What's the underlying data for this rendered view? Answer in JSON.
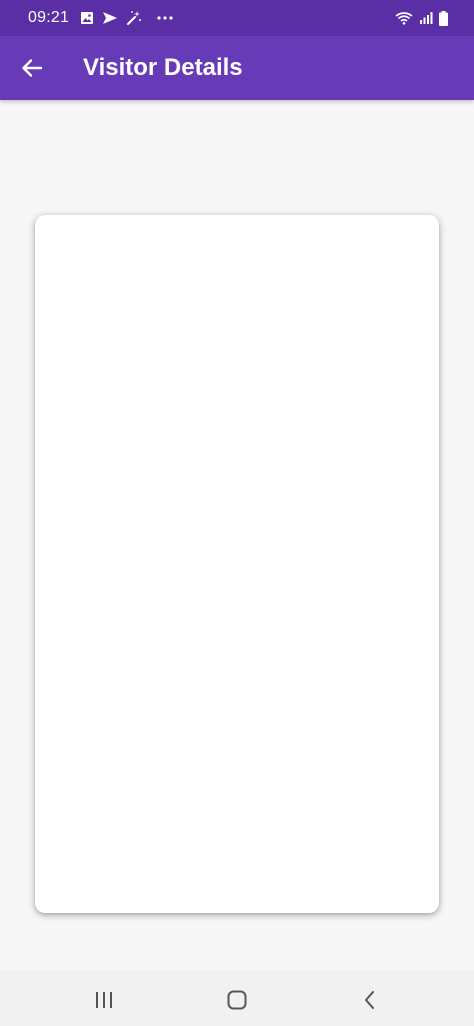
{
  "status_bar": {
    "time": "09:21",
    "left_icons": [
      "image-icon",
      "send-icon",
      "magic-wand-icon",
      "more-dots-icon"
    ],
    "right_icons": [
      "wifi-icon",
      "signal-icon",
      "battery-icon"
    ]
  },
  "app_bar": {
    "title": "Visitor Details",
    "back_icon": "arrow-left-icon",
    "color": "#673ab7"
  },
  "colors": {
    "status_bar": "#5a2fa6",
    "background": "#f7f7f7",
    "card": "#ffffff",
    "nav_bar": "#f1f1f1"
  },
  "nav_bar": {
    "buttons": [
      "recents-icon",
      "home-icon",
      "back-chevron-icon"
    ]
  }
}
